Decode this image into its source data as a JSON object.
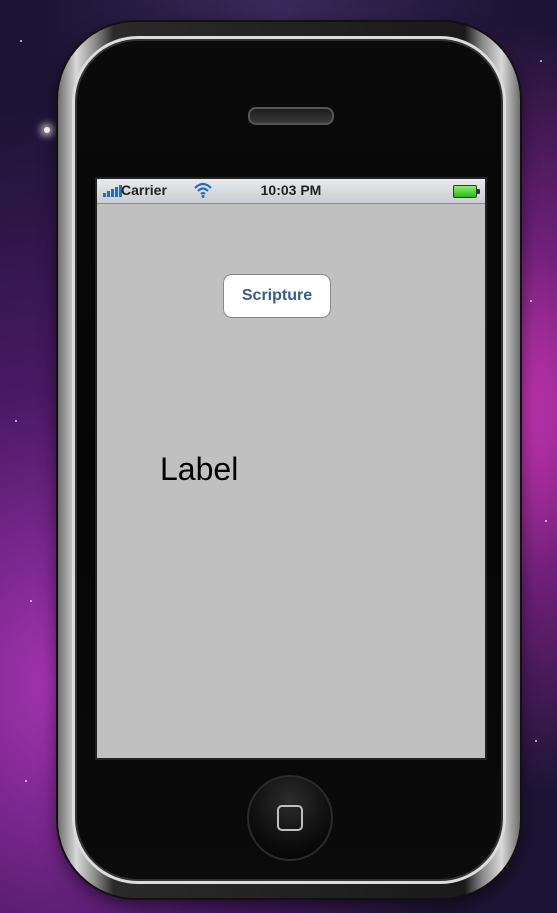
{
  "status_bar": {
    "carrier": "Carrier",
    "time": "10:03 PM"
  },
  "screen": {
    "button_label": "Scripture",
    "label_text": "Label",
    "background_color": "#c0c0c0"
  },
  "icons": {
    "signal": "signal-bars-icon",
    "wifi": "wifi-icon",
    "battery": "battery-icon",
    "home": "home-button-icon"
  }
}
